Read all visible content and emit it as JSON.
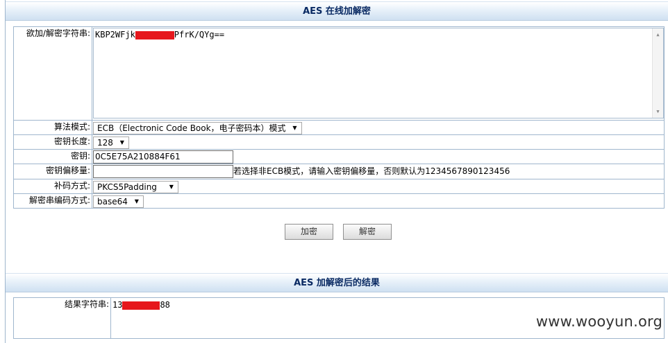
{
  "panel": {
    "title": "AES 在线加解密"
  },
  "form": {
    "input_label": "欲加/解密字符串:",
    "input_text_start": "KBP2WFjk",
    "input_text_end": "PfrK/QYg==",
    "mode_label": "算法模式:",
    "mode_value": "ECB（Electronic Code Book，电子密码本）模式",
    "keylen_label": "密钥长度:",
    "keylen_value": "128",
    "key_label": "密钥:",
    "key_value": "0C5E75A210884F61",
    "iv_label": "密钥偏移量:",
    "iv_value": "",
    "iv_hint": "若选择非ECB模式，请输入密钥偏移量，否则默认为1234567890123456",
    "padding_label": "补码方式:",
    "padding_value": "PKCS5Padding",
    "encoding_label": "解密串编码方式:",
    "encoding_value": "base64"
  },
  "buttons": {
    "encrypt": "加密",
    "decrypt": "解密"
  },
  "result": {
    "title": "AES 加解密后的结果",
    "label": "结果字符串:",
    "text_start": "13",
    "text_end": "88"
  },
  "watermark": "www.wooyun.org",
  "colors": {
    "title_text": "#0a2a63",
    "border": "#9fb6cd",
    "redaction": "#e6171c"
  },
  "icons": {
    "dropdown": "triangle-down",
    "scroll_up": "triangle-up",
    "scroll_down": "triangle-down"
  }
}
